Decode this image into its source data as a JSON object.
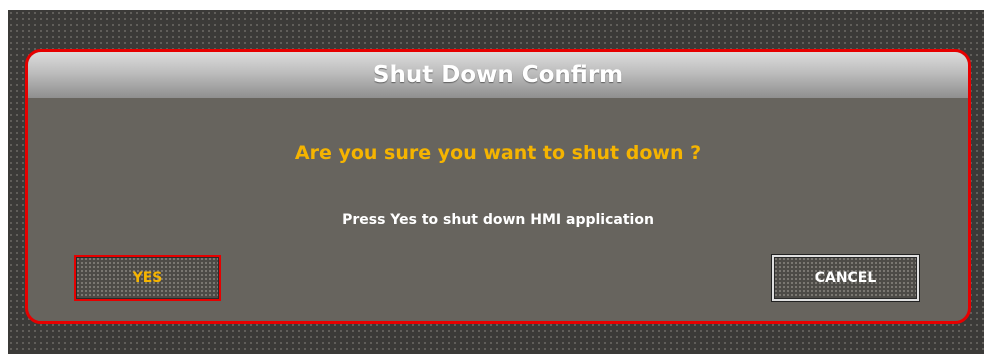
{
  "dialog": {
    "title": "Shut Down Confirm",
    "question": "Are you sure you want to shut down ?",
    "info": "Press Yes to shut down HMI application",
    "yes_label": "YES",
    "cancel_label": "CANCEL"
  },
  "colors": {
    "backdrop": "#3b3a38",
    "dialog_border": "#e60000",
    "dialog_body": "#67645e",
    "question_text": "#f5b400",
    "info_text": "#ffffff"
  }
}
